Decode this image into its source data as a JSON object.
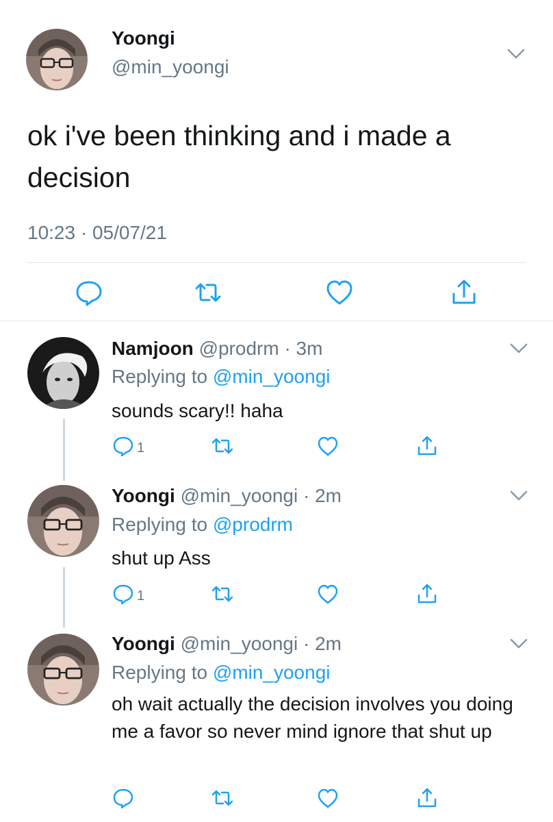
{
  "main_tweet": {
    "author_name": "Yoongi",
    "author_handle": "@min_yoongi",
    "text": "ok i've been thinking and i made a decision",
    "timestamp": "10:23 · 05/07/21",
    "avatar_icon": "profile-photo-glasses"
  },
  "replies": [
    {
      "author_name": "Namjoon",
      "meta": "@prodrm · 3m",
      "replying_prefix": "Replying to ",
      "replying_to": "@min_yoongi",
      "text": "sounds scary!! haha",
      "reply_count": "1",
      "avatar_icon": "profile-photo-bw"
    },
    {
      "author_name": "Yoongi",
      "meta": "@min_yoongi · 2m",
      "replying_prefix": "Replying to ",
      "replying_to": "@prodrm",
      "text": "shut up Ass",
      "reply_count": "1",
      "avatar_icon": "profile-photo-glasses"
    },
    {
      "author_name": "Yoongi",
      "meta": "@min_yoongi · 2m",
      "replying_prefix": "Replying to ",
      "replying_to": "@min_yoongi",
      "text": "oh wait actually the decision involves you doing me a favor so never mind ignore that shut up",
      "reply_count": "",
      "avatar_icon": "profile-photo-glasses"
    }
  ],
  "colors": {
    "text": "#14171a",
    "secondary": "#657786",
    "link": "#1da1f2",
    "divider": "#e1e8ed",
    "icon": "#1da1f2"
  }
}
